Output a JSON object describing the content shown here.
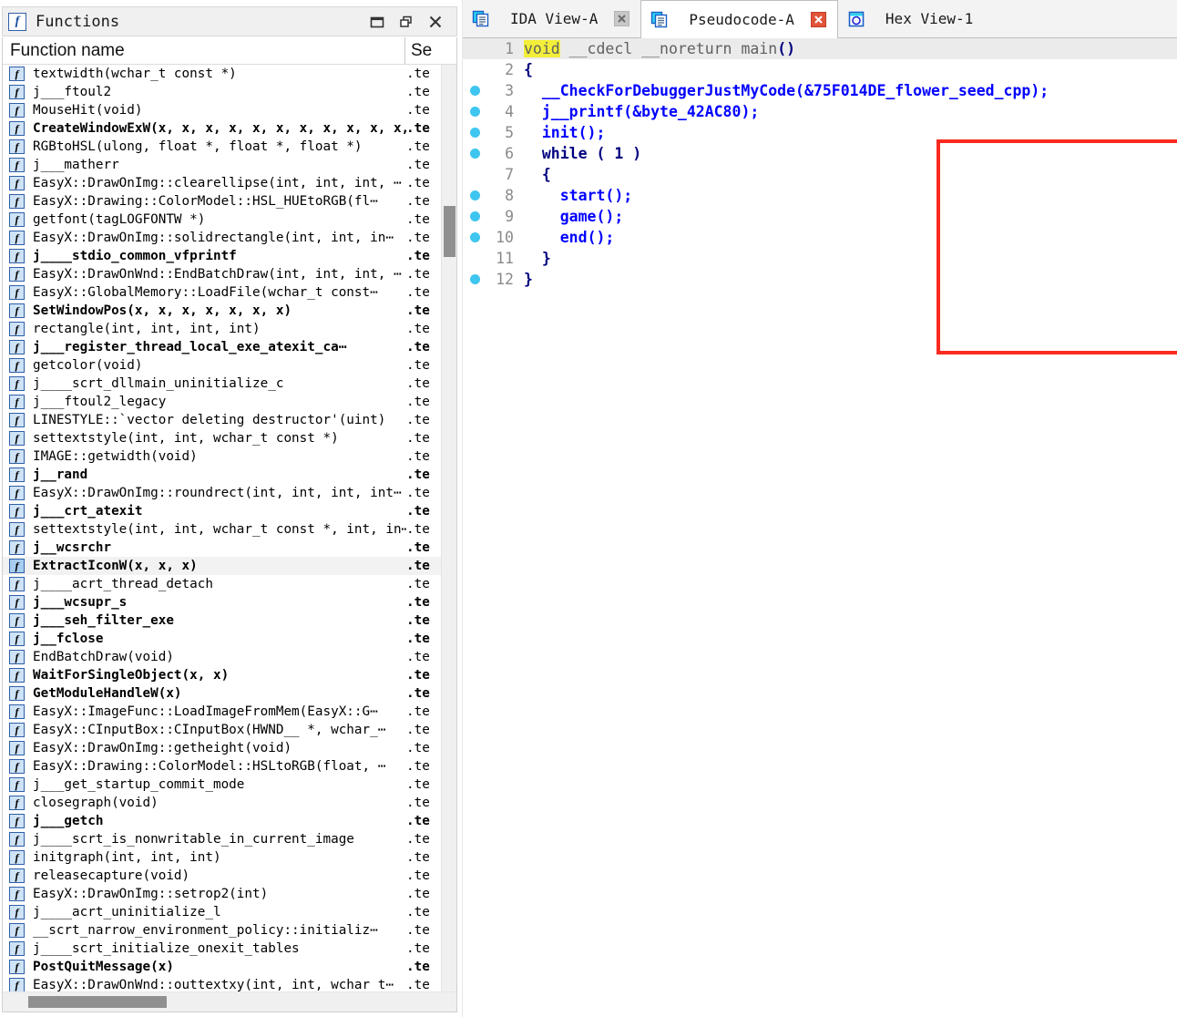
{
  "functions_panel": {
    "title": "Functions",
    "title_icon": "function-icon",
    "window_buttons": [
      {
        "name": "dock-button",
        "icon": "maximize-icon"
      },
      {
        "name": "float-button",
        "icon": "restore-icon"
      },
      {
        "name": "close-button",
        "icon": "close-icon"
      }
    ],
    "columns": {
      "name": "Function name",
      "segment": "Se"
    },
    "segment_value": ".te",
    "rows": [
      {
        "name": "textwidth(wchar_t const *)",
        "bold": false
      },
      {
        "name": "j___ftoul2",
        "bold": false
      },
      {
        "name": "MouseHit(void)",
        "bold": false
      },
      {
        "name": "CreateWindowExW(x, x, x, x, x, x, x, x, x, x, x, x)",
        "bold": true
      },
      {
        "name": "RGBtoHSL(ulong, float *, float *, float *)",
        "bold": false
      },
      {
        "name": "j___matherr",
        "bold": false
      },
      {
        "name": "EasyX::DrawOnImg::clearellipse(int, int, int, ⋯",
        "bold": false
      },
      {
        "name": "EasyX::Drawing::ColorModel::HSL_HUEtoRGB(fl⋯",
        "bold": false
      },
      {
        "name": "getfont(tagLOGFONTW *)",
        "bold": false
      },
      {
        "name": "EasyX::DrawOnImg::solidrectangle(int, int, in⋯",
        "bold": false
      },
      {
        "name": "j____stdio_common_vfprintf",
        "bold": true
      },
      {
        "name": "EasyX::DrawOnWnd::EndBatchDraw(int, int, int, ⋯",
        "bold": false
      },
      {
        "name": "EasyX::GlobalMemory::LoadFile(wchar_t const⋯",
        "bold": false
      },
      {
        "name": "SetWindowPos(x, x, x, x, x, x, x)",
        "bold": true
      },
      {
        "name": "rectangle(int, int, int, int)",
        "bold": false
      },
      {
        "name": "j___register_thread_local_exe_atexit_ca⋯",
        "bold": true
      },
      {
        "name": "getcolor(void)",
        "bold": false
      },
      {
        "name": "j____scrt_dllmain_uninitialize_c",
        "bold": false
      },
      {
        "name": "j___ftoul2_legacy",
        "bold": false
      },
      {
        "name": "LINESTYLE::`vector deleting destructor'(uint)",
        "bold": false
      },
      {
        "name": "settextstyle(int, int, wchar_t const *)",
        "bold": false
      },
      {
        "name": "IMAGE::getwidth(void)",
        "bold": false
      },
      {
        "name": "j__rand",
        "bold": true
      },
      {
        "name": "EasyX::DrawOnImg::roundrect(int, int, int, int⋯",
        "bold": false
      },
      {
        "name": "j___crt_atexit",
        "bold": true
      },
      {
        "name": "settextstyle(int, int, wchar_t const *, int, in⋯",
        "bold": false
      },
      {
        "name": "j__wcsrchr",
        "bold": true
      },
      {
        "name": "ExtractIconW(x, x, x)",
        "bold": true,
        "selected": true
      },
      {
        "name": "j____acrt_thread_detach",
        "bold": false
      },
      {
        "name": "j___wcsupr_s",
        "bold": true
      },
      {
        "name": "j___seh_filter_exe",
        "bold": true
      },
      {
        "name": "j__fclose",
        "bold": true
      },
      {
        "name": "EndBatchDraw(void)",
        "bold": false
      },
      {
        "name": "WaitForSingleObject(x, x)",
        "bold": true
      },
      {
        "name": "GetModuleHandleW(x)",
        "bold": true
      },
      {
        "name": "EasyX::ImageFunc::LoadImageFromMem(EasyX::G⋯",
        "bold": false
      },
      {
        "name": "EasyX::CInputBox::CInputBox(HWND__ *, wchar_⋯",
        "bold": false
      },
      {
        "name": "EasyX::DrawOnImg::getheight(void)",
        "bold": false
      },
      {
        "name": "EasyX::Drawing::ColorModel::HSLtoRGB(float, ⋯",
        "bold": false
      },
      {
        "name": "j___get_startup_commit_mode",
        "bold": false
      },
      {
        "name": "closegraph(void)",
        "bold": false
      },
      {
        "name": "j___getch",
        "bold": true
      },
      {
        "name": "j____scrt_is_nonwritable_in_current_image",
        "bold": false
      },
      {
        "name": "initgraph(int, int, int)",
        "bold": false
      },
      {
        "name": "releasecapture(void)",
        "bold": false
      },
      {
        "name": "EasyX::DrawOnImg::setrop2(int)",
        "bold": false
      },
      {
        "name": "j____acrt_uninitialize_l",
        "bold": false
      },
      {
        "name": "__scrt_narrow_environment_policy::initializ⋯",
        "bold": false
      },
      {
        "name": "j____scrt_initialize_onexit_tables",
        "bold": false
      },
      {
        "name": "PostQuitMessage(x)",
        "bold": true
      },
      {
        "name": "EasyX::DrawOnWnd::outtextxy(int, int, wchar_t⋯",
        "bold": false
      }
    ]
  },
  "tabs": [
    {
      "label": "IDA View-A",
      "icon": "document-icon",
      "active": false,
      "close_style": "grey",
      "close_icon": "close-icon"
    },
    {
      "label": "Pseudocode-A",
      "icon": "document-icon",
      "active": true,
      "close_style": "red",
      "close_icon": "close-icon"
    },
    {
      "label": "Hex View-1",
      "icon": "hex-icon",
      "active": false,
      "close_style": "none",
      "close_icon": ""
    }
  ],
  "pseudocode": {
    "current_line": 1,
    "highlight_token": "void",
    "lines": [
      {
        "num": "1",
        "bp": false,
        "current": true,
        "tokens": [
          {
            "t": "void",
            "c": "k-type",
            "hl": true
          },
          {
            "t": " __cdecl __noreturn ",
            "c": "k-type"
          },
          {
            "t": "main",
            "c": "k-type"
          },
          {
            "t": "()",
            "c": "k-punct"
          }
        ]
      },
      {
        "num": "2",
        "bp": false,
        "current": false,
        "tokens": [
          {
            "t": "{",
            "c": "k-punct"
          }
        ]
      },
      {
        "num": "3",
        "bp": true,
        "current": false,
        "tokens": [
          {
            "t": "  ",
            "c": "k-plain"
          },
          {
            "t": "__CheckForDebuggerJustMyCode",
            "c": "k-fn"
          },
          {
            "t": "(&",
            "c": "k-fn"
          },
          {
            "t": "75F014DE_flower_seed_cpp",
            "c": "k-fn"
          },
          {
            "t": ");",
            "c": "k-fn"
          }
        ]
      },
      {
        "num": "4",
        "bp": true,
        "current": false,
        "tokens": [
          {
            "t": "  ",
            "c": "k-plain"
          },
          {
            "t": "j__printf",
            "c": "k-fn"
          },
          {
            "t": "(&",
            "c": "k-fn"
          },
          {
            "t": "byte_42AC80",
            "c": "k-fn"
          },
          {
            "t": ");",
            "c": "k-fn"
          }
        ]
      },
      {
        "num": "5",
        "bp": true,
        "current": false,
        "tokens": [
          {
            "t": "  ",
            "c": "k-plain"
          },
          {
            "t": "init",
            "c": "k-fn"
          },
          {
            "t": "();",
            "c": "k-fn"
          }
        ]
      },
      {
        "num": "6",
        "bp": true,
        "current": false,
        "tokens": [
          {
            "t": "  ",
            "c": "k-plain"
          },
          {
            "t": "while",
            "c": "k-kw"
          },
          {
            "t": " ( ",
            "c": "k-punct"
          },
          {
            "t": "1",
            "c": "k-num"
          },
          {
            "t": " )",
            "c": "k-punct"
          }
        ]
      },
      {
        "num": "7",
        "bp": false,
        "current": false,
        "tokens": [
          {
            "t": "  {",
            "c": "k-punct"
          }
        ]
      },
      {
        "num": "8",
        "bp": true,
        "current": false,
        "tokens": [
          {
            "t": "    ",
            "c": "k-plain"
          },
          {
            "t": "start",
            "c": "k-fn"
          },
          {
            "t": "();",
            "c": "k-fn"
          }
        ]
      },
      {
        "num": "9",
        "bp": true,
        "current": false,
        "tokens": [
          {
            "t": "    ",
            "c": "k-plain"
          },
          {
            "t": "game",
            "c": "k-fn"
          },
          {
            "t": "();",
            "c": "k-fn"
          }
        ]
      },
      {
        "num": "10",
        "bp": true,
        "current": false,
        "tokens": [
          {
            "t": "    ",
            "c": "k-plain"
          },
          {
            "t": "end",
            "c": "k-fn"
          },
          {
            "t": "();",
            "c": "k-fn"
          }
        ]
      },
      {
        "num": "11",
        "bp": false,
        "current": false,
        "tokens": [
          {
            "t": "  }",
            "c": "k-punct"
          }
        ]
      },
      {
        "num": "12",
        "bp": true,
        "current": false,
        "tokens": [
          {
            "t": "}",
            "c": "k-punct"
          }
        ]
      }
    ]
  },
  "annotation": {
    "name": "red-highlight-rectangle",
    "color": "#fa2a20",
    "covers_lines": "6-12"
  },
  "colors": {
    "breakpoint_dot": "#3ec6f0",
    "keyword": "#000080",
    "function_call": "#0000ff",
    "type_text": "#606060",
    "search_highlight": "#f2ee3a",
    "current_line_bg": "#ebebeb",
    "selected_row_bg": "#f2f2f2",
    "tab_close_active": "#e2543a",
    "tab_close_inactive": "#c8c8c8"
  }
}
